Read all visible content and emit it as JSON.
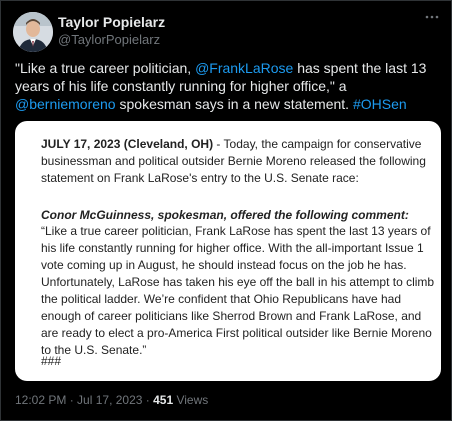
{
  "author": {
    "name": "Taylor Popielarz",
    "handle": "@TaylorPopielarz"
  },
  "more_icon": "more-horizontal-icon",
  "tweet": {
    "quote_open": "\"Like a true career politician, ",
    "mention1": "@FrankLaRose",
    "text_mid": " has spent the last 13 years of his life constantly running for higher office,\" a ",
    "mention2": "@berniemoreno",
    "text_end": " spokesman says in a new statement. ",
    "hashtag": "#OHSen"
  },
  "statement": {
    "dateline": "JULY 17, 2023 (Cleveland, OH)",
    "intro": " - Today, the campaign for conservative businessman and political outsider Bernie Moreno released the following statement on Frank LaRose's entry to the U.S. Senate race:",
    "quote_attribution": "Conor McGuinness, spokesman, offered the following comment:",
    "quote_body": "“Like a true career politician, Frank LaRose has spent the last 13 years of his life constantly running for higher office. With the all-important Issue 1 vote coming up in August, he should instead focus on the job he has. Unfortunately, LaRose has taken his eye off the ball in his attempt to climb the political ladder. We’re confident that Ohio Republicans have had enough of career politicians like Sherrod Brown and Frank LaRose, and are ready to elect a pro-America First political outsider like Bernie Moreno to the U.S. Senate.”",
    "end_mark": "###"
  },
  "meta": {
    "time": "12:02 PM",
    "separator": " · ",
    "date": "Jul 17, 2023",
    "views_count": "451",
    "views_label": " Views"
  }
}
